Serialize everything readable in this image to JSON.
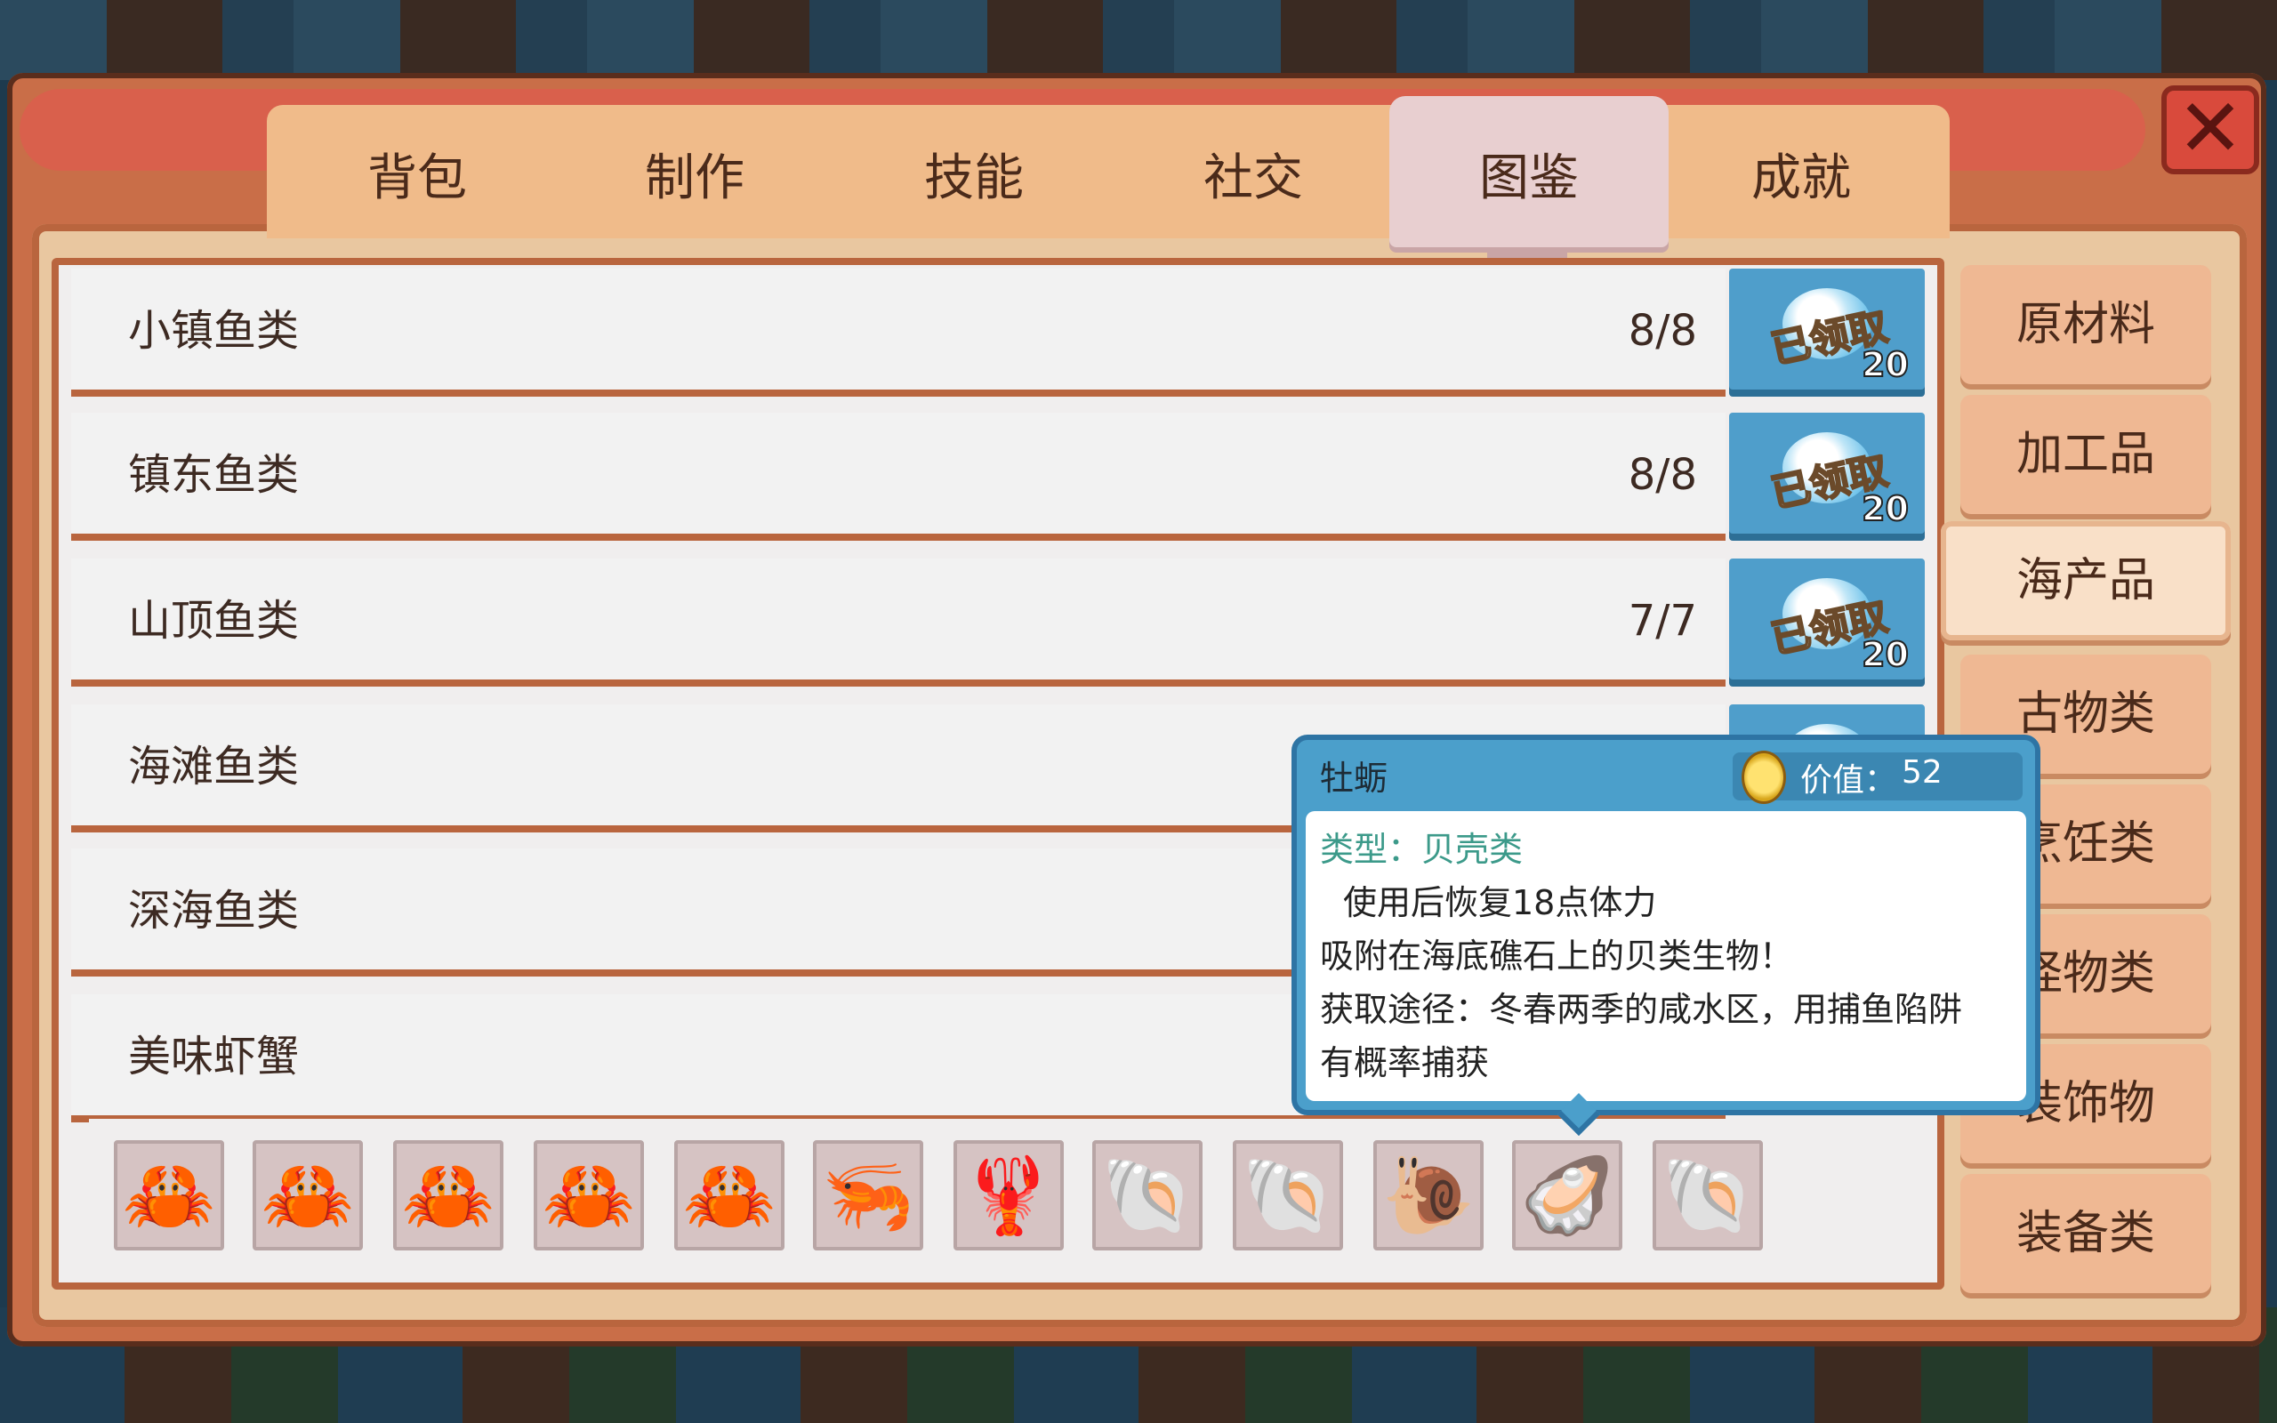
{
  "tabs": [
    "背包",
    "制作",
    "技能",
    "社交",
    "图鉴",
    "成就"
  ],
  "active_tab": "图鉴",
  "close_label": "✕",
  "collection_rows": [
    {
      "name": "小镇鱼类",
      "count": "8/8",
      "reward_stamp": "已领取",
      "reward_amount": "20"
    },
    {
      "name": "镇东鱼类",
      "count": "8/8",
      "reward_stamp": "已领取",
      "reward_amount": "20"
    },
    {
      "name": "山顶鱼类",
      "count": "7/7",
      "reward_stamp": "已领取",
      "reward_amount": "20"
    },
    {
      "name": "海滩鱼类",
      "count": "",
      "reward_stamp": "",
      "reward_amount": ""
    },
    {
      "name": "深海鱼类",
      "count": "",
      "reward_stamp": "",
      "reward_amount": ""
    },
    {
      "name": "美味虾蟹",
      "count": "",
      "reward_stamp": "",
      "reward_amount": ""
    }
  ],
  "items": [
    {
      "icon": "crab-icon",
      "glyph": "🦀"
    },
    {
      "icon": "yellow-crab-icon",
      "glyph": "🦀"
    },
    {
      "icon": "orange-crab-icon",
      "glyph": "🦀"
    },
    {
      "icon": "blue-eyed-crab-icon",
      "glyph": "🦀"
    },
    {
      "icon": "spider-crab-icon",
      "glyph": "🦀"
    },
    {
      "icon": "shrimp-icon",
      "glyph": "🦐"
    },
    {
      "icon": "lobster-icon",
      "glyph": "🦞"
    },
    {
      "icon": "clam-icon",
      "glyph": "🐚"
    },
    {
      "icon": "scallop-icon",
      "glyph": "🐚"
    },
    {
      "icon": "sea-snail-icon",
      "glyph": "🐌"
    },
    {
      "icon": "oyster-icon",
      "glyph": "🦪"
    },
    {
      "icon": "mussel-icon",
      "glyph": "🐚"
    }
  ],
  "categories": [
    "原材料",
    "加工品",
    "海产品",
    "古物类",
    "烹饪类",
    "怪物类",
    "装饰物",
    "装备类"
  ],
  "active_category": "海产品",
  "tooltip": {
    "name": "牡蛎",
    "value_label": "价值：",
    "value": "52",
    "type_line": "类型：贝壳类",
    "effect_line": "使用后恢复18点体力",
    "desc_line": "吸附在海底礁石上的贝类生物！",
    "source_line1": "获取途径：冬春两季的咸水区，用捕鱼陷阱",
    "source_line2": "有概率捕获"
  }
}
